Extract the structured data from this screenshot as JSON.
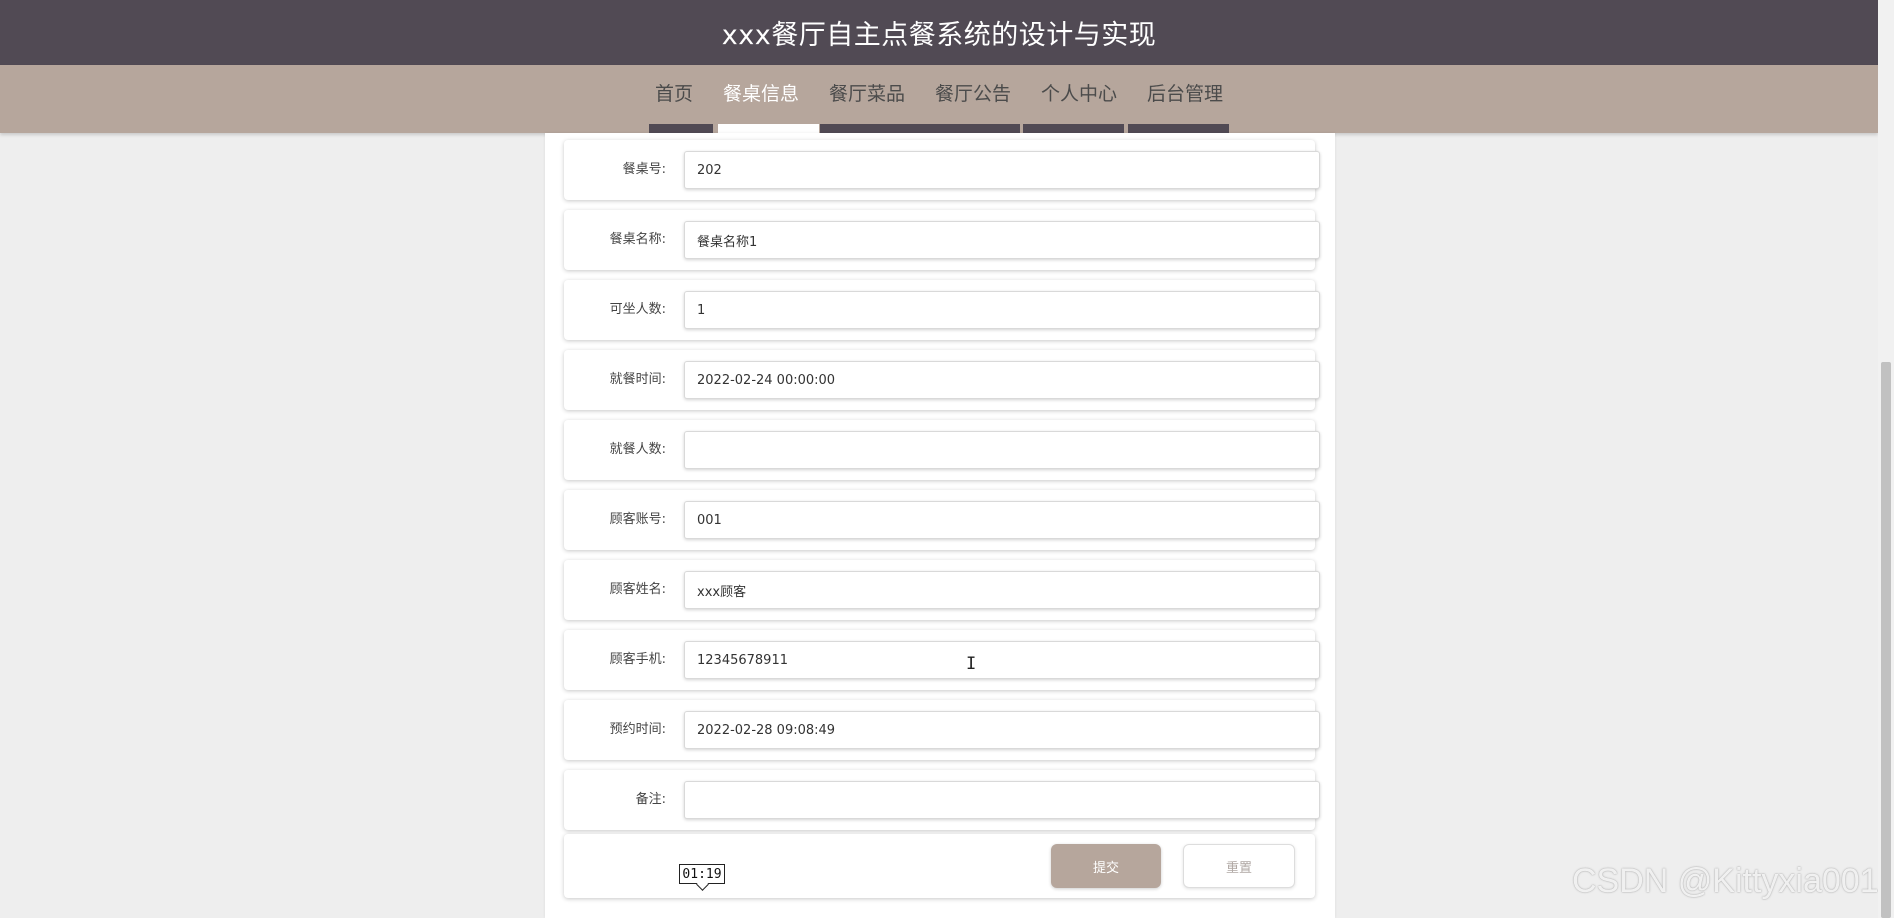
{
  "header": {
    "title": "xxx餐厅自主点餐系统的设计与实现"
  },
  "nav": {
    "items": [
      {
        "label": "首页"
      },
      {
        "label": "餐桌信息"
      },
      {
        "label": "餐厅菜品"
      },
      {
        "label": "餐厅公告"
      },
      {
        "label": "个人中心"
      },
      {
        "label": "后台管理"
      }
    ],
    "active_label": "餐桌信息"
  },
  "form": {
    "fields": [
      {
        "label": "餐桌号:",
        "value": "202"
      },
      {
        "label": "餐桌名称:",
        "value": "餐桌名称1"
      },
      {
        "label": "可坐人数:",
        "value": "1"
      },
      {
        "label": "就餐时间:",
        "value": "2022-02-24 00:00:00"
      },
      {
        "label": "就餐人数:",
        "value": ""
      },
      {
        "label": "顾客账号:",
        "value": "001"
      },
      {
        "label": "顾客姓名:",
        "value": "xxx顾客"
      },
      {
        "label": "顾客手机:",
        "value": "12345678911"
      },
      {
        "label": "预约时间:",
        "value": "2022-02-28 09:08:49"
      },
      {
        "label": "备注:",
        "value": ""
      }
    ],
    "submit_label": "提交",
    "reset_label": "重置"
  },
  "overlay": {
    "timestamp": "01:19",
    "watermark": "CSDN @Kittyxia001"
  },
  "colors": {
    "header_bg": "#514a54",
    "nav_bg": "#b6a69c",
    "submit_bg": "#b6a69c",
    "page_bg": "#eeeeee"
  }
}
